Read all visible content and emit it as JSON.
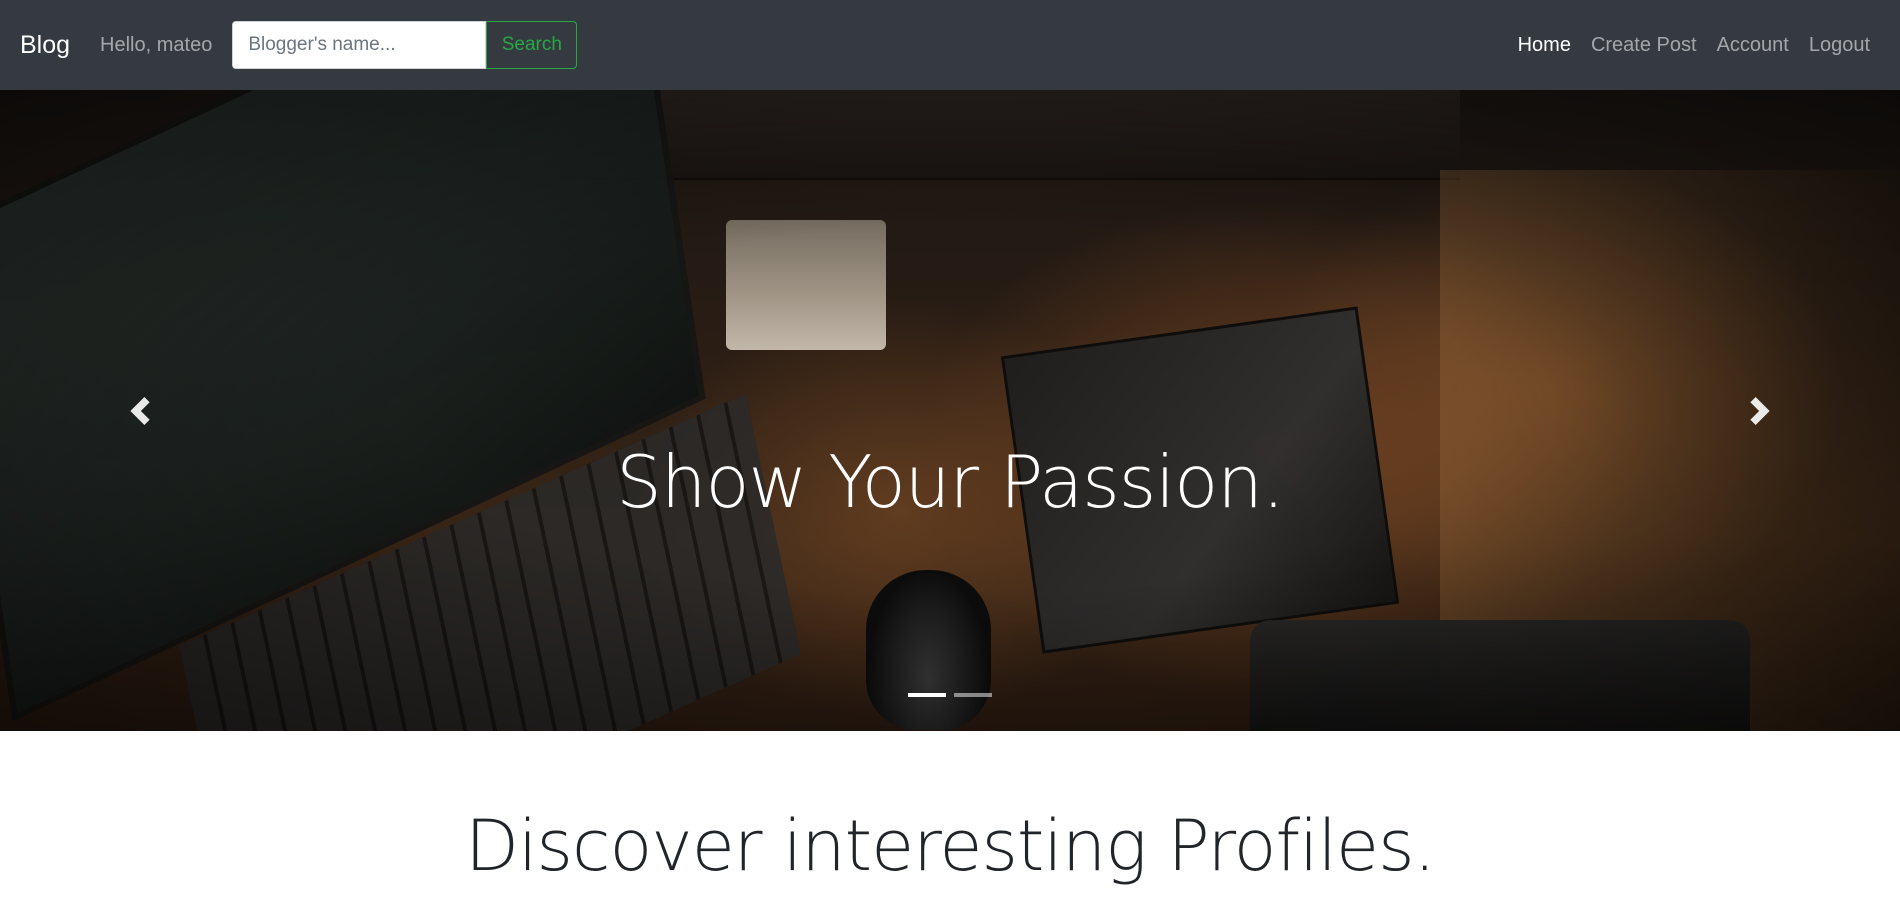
{
  "navbar": {
    "brand": "Blog",
    "greeting": "Hello, mateo",
    "search": {
      "placeholder": "Blogger's name...",
      "value": "",
      "button_label": "Search"
    },
    "links": [
      {
        "label": "Home",
        "active": true
      },
      {
        "label": "Create Post",
        "active": false
      },
      {
        "label": "Account",
        "active": false
      },
      {
        "label": "Logout",
        "active": false
      }
    ]
  },
  "carousel": {
    "caption": "Show Your Passion.",
    "indicator_count": 2,
    "active_indicator": 0,
    "icons": {
      "prev": "chevron-left-icon",
      "next": "chevron-right-icon"
    }
  },
  "main": {
    "heading": "Discover interesting Profiles."
  },
  "colors": {
    "navbar_bg": "#343a40",
    "success": "#28a745",
    "text_dark": "#212529"
  }
}
